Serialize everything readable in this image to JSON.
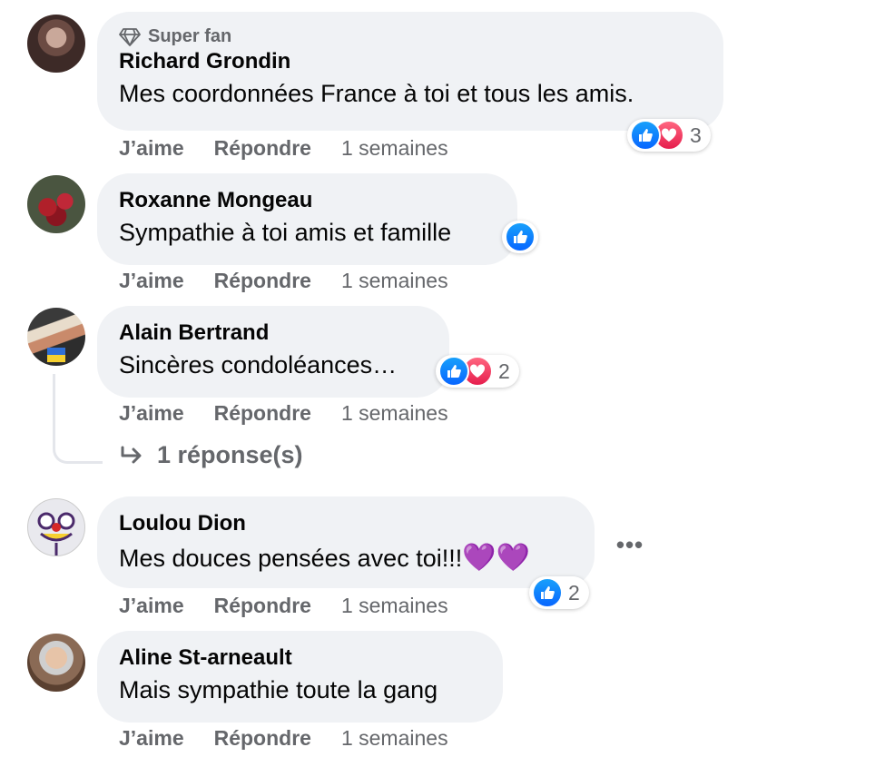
{
  "comments": [
    {
      "badge": "Super fan",
      "author": "Richard Grondin",
      "text": "Mes coordonnées France à toi et tous les amis.",
      "reactions": [
        "like",
        "love"
      ],
      "reaction_count": "3",
      "like_label": "J’aime",
      "reply_label": "Répondre",
      "time": "1 semaines"
    },
    {
      "author": "Roxanne Mongeau",
      "text": "Sympathie à toi amis et famille",
      "reactions": [
        "like"
      ],
      "like_label": "J’aime",
      "reply_label": "Répondre",
      "time": "1 semaines"
    },
    {
      "author": "Alain Bertrand",
      "text": "Sincères condoléances…",
      "reactions": [
        "like",
        "love"
      ],
      "reaction_count": "2",
      "like_label": "J’aime",
      "reply_label": "Répondre",
      "time": "1 semaines",
      "replies_label": "1 réponse(s)"
    },
    {
      "author": "Loulou Dion",
      "text": "Mes douces pensées avec toi!!!",
      "emoji": "💜💜",
      "reactions": [
        "like"
      ],
      "reaction_count": "2",
      "like_label": "J’aime",
      "reply_label": "Répondre",
      "time": "1 semaines",
      "more_label": "•••"
    },
    {
      "author": "Aline St-arneault",
      "text": "Mais sympathie toute la gang",
      "like_label": "J’aime",
      "reply_label": "Répondre",
      "time": "1 semaines"
    }
  ],
  "colors": {
    "bubble": "#f0f2f5",
    "secondary_text": "#65676b",
    "like_blue": "#0866ff",
    "love_red": "#f33e58"
  }
}
